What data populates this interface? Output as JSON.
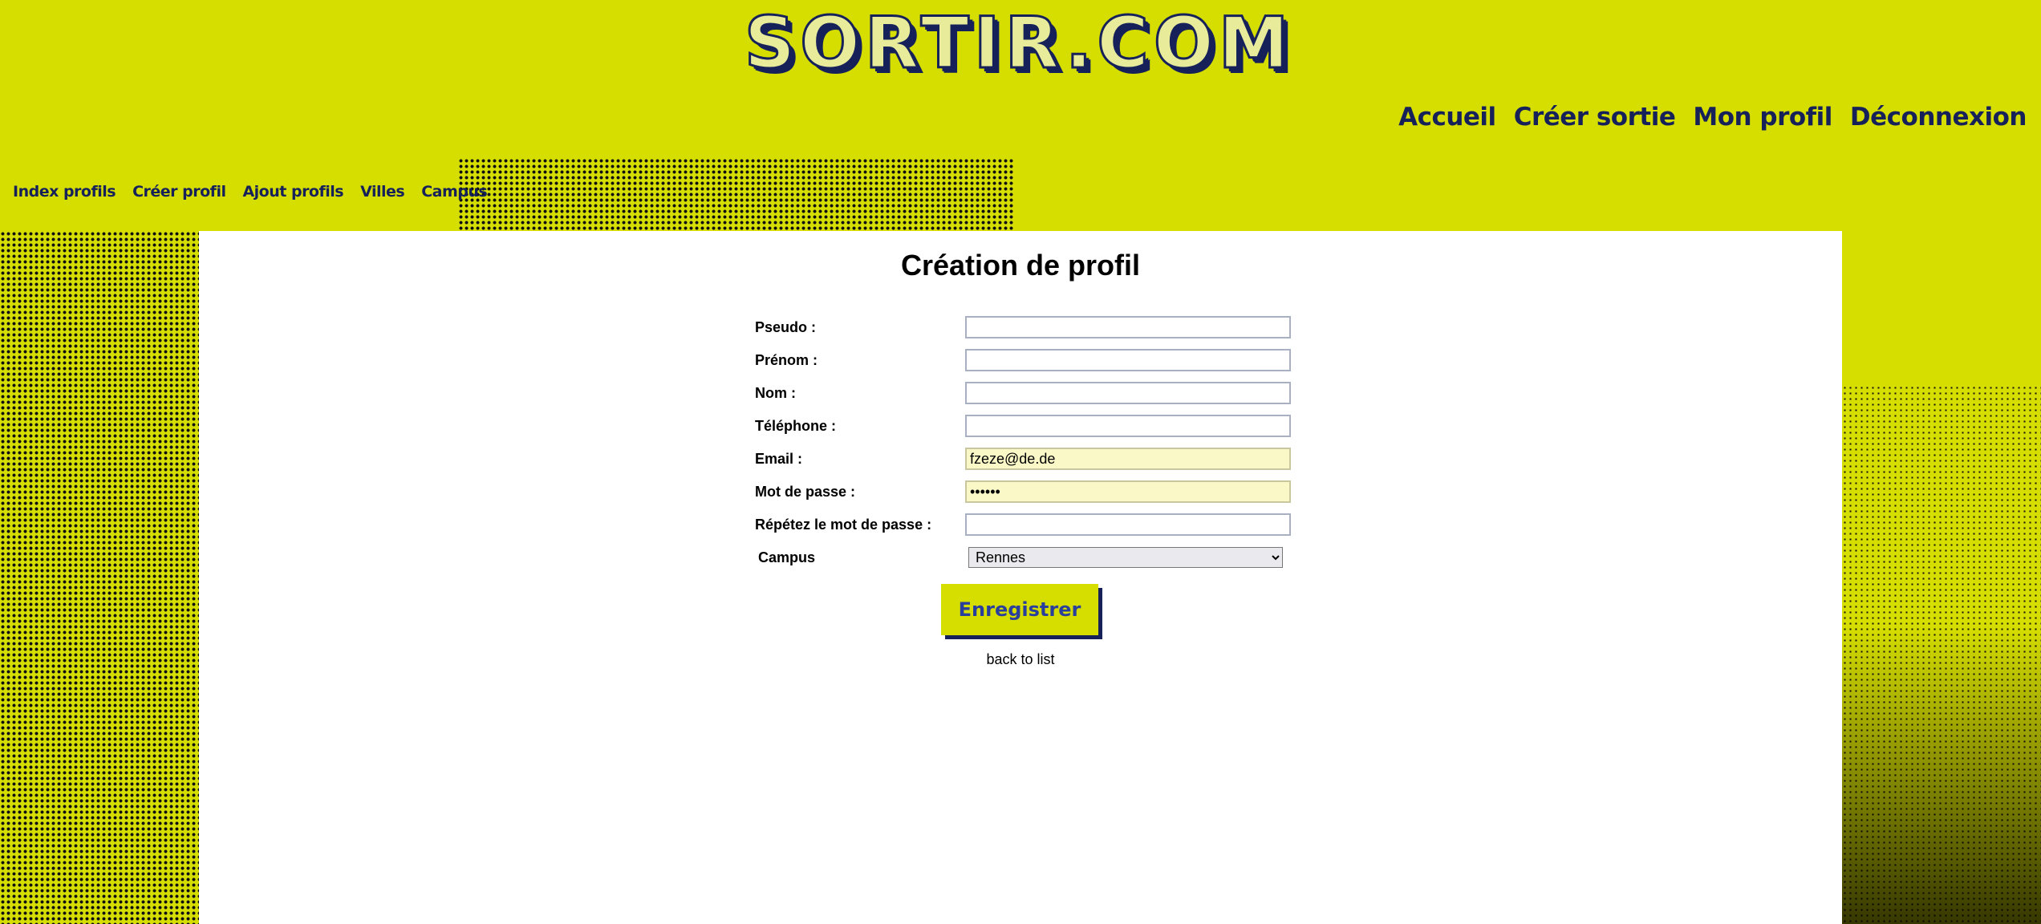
{
  "header": {
    "logo_text": "SORTIR.COM",
    "main_nav": [
      "Accueil",
      "Créer sortie",
      "Mon profil",
      "Déconnexion"
    ],
    "sub_nav": [
      "Index profils",
      "Créer profil",
      "Ajout profils",
      "Villes",
      "Campus"
    ]
  },
  "main": {
    "title": "Création de profil",
    "form": {
      "pseudo_label": "Pseudo :",
      "pseudo_value": "",
      "prenom_label": "Prénom :",
      "prenom_value": "",
      "nom_label": "Nom :",
      "nom_value": "",
      "telephone_label": "Téléphone :",
      "telephone_value": "",
      "email_label": "Email :",
      "email_value": "fzeze@de.de",
      "password_label": "Mot de passe :",
      "password_value": "123456",
      "password_repeat_label": "Répétez le mot de passe :",
      "password_repeat_value": "",
      "campus_label": "Campus",
      "campus_value": "Rennes"
    },
    "submit_label": "Enregistrer",
    "back_link": "back to list"
  },
  "colors": {
    "brand_yellow": "#d6de00",
    "nav_navy": "#16215a",
    "button_text": "#2a3f9c"
  }
}
